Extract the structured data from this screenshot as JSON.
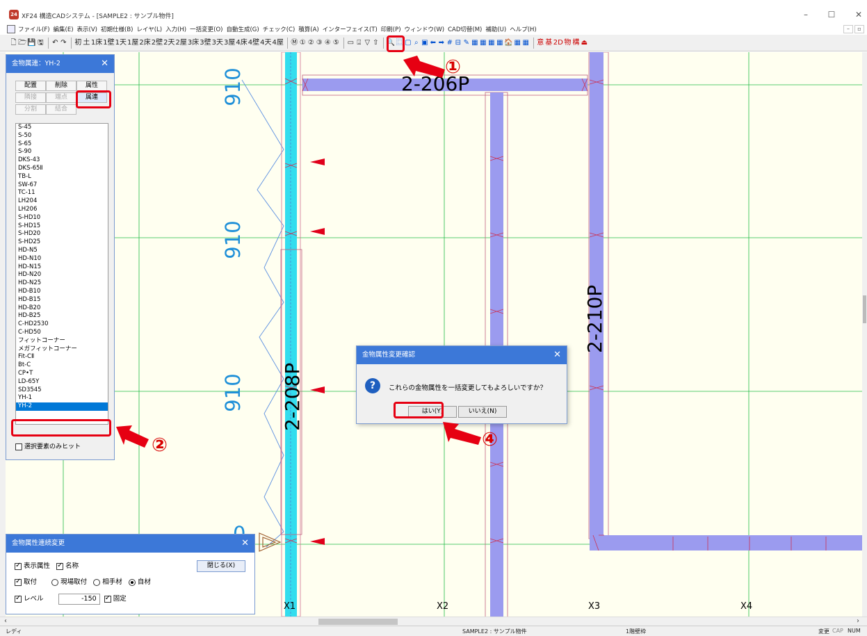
{
  "window": {
    "title": "XF24 構造CADシステム - [SAMPLE2 : サンプル物件]",
    "app_icon": "24"
  },
  "menu": [
    "ファイル(F)",
    "編集(E)",
    "表示(V)",
    "初期仕様(B)",
    "レイヤ(L)",
    "入力(H)",
    "一括変更(O)",
    "自動生成(G)",
    "チェック(C)",
    "積算(A)",
    "インターフェイス(T)",
    "印刷(P)",
    "ウィンドウ(W)",
    "CAD切替(M)",
    "補助(U)",
    "ヘルプ(H)"
  ],
  "toolbar": {
    "file_icons": [
      "🗋",
      "🗁",
      "💾",
      "🖫"
    ],
    "undo_icons": [
      "↶",
      "↷"
    ],
    "layers": [
      "初",
      "土",
      "1床",
      "1壁",
      "1天",
      "1屋",
      "2床",
      "2壁",
      "2天",
      "2屋",
      "3床",
      "3壁",
      "3天",
      "3屋",
      "4床",
      "4壁",
      "4天",
      "4屋"
    ],
    "circles": [
      "Ⓜ",
      "①",
      "②",
      "③",
      "④",
      "⑤"
    ],
    "tools_mid": [
      "▭",
      "⍗",
      "▽",
      "⇧"
    ],
    "tools_view": [
      "🔍",
      "⿴",
      "▢",
      "⌕",
      "▣",
      "⬅",
      "➡",
      "#",
      "⊟",
      "✎",
      "▦",
      "▦",
      "▦",
      "▦",
      "🏠",
      "▦",
      "▦"
    ],
    "right_labels": [
      "意",
      "基",
      "2D",
      "物",
      "構",
      "⏏"
    ]
  },
  "kanagu_panel": {
    "title": "金物属連：YH-2",
    "buttons": [
      "配置",
      "削除",
      "属性",
      "隣接",
      "端点",
      "属連",
      "分割",
      "結合"
    ],
    "list": [
      "S-45",
      "S-50",
      "S-65",
      "S-90",
      "DKS-43",
      "DKS-65Ⅱ",
      "TB-L",
      "SW-67",
      "TC-11",
      "LH204",
      "LH206",
      "S-HD10",
      "S-HD15",
      "S-HD20",
      "S-HD25",
      "HD-N5",
      "HD-N10",
      "HD-N15",
      "HD-N20",
      "HD-N25",
      "HD-B10",
      "HD-B15",
      "HD-B20",
      "HD-B25",
      "C-HD2530",
      "C-HD50",
      "フィットコーナー",
      "メガフィットコーナー",
      "Fit-CⅡ",
      "Bt-C",
      "CP•T",
      "LD-65Y",
      "SD3545",
      "YH-1",
      "YH-2"
    ],
    "selected": "YH-2",
    "checkbox": "選択要素のみヒット"
  },
  "renzoku_panel": {
    "title": "金物属性連続変更",
    "display_attr": "表示属性",
    "name": "名称",
    "close": "閉じる(X)",
    "attach": "取付",
    "opt_genba": "現場取付",
    "opt_aite": "相手材",
    "opt_jizai": "自材",
    "level": "レベル",
    "level_value": "-150",
    "fixed": "固定"
  },
  "confirm_dialog": {
    "title": "金物属性変更確認",
    "message": "これらの金物属性を一括変更してもよろしいですか？",
    "yes": "はい(Y)",
    "no": "いいえ(N)"
  },
  "drawing": {
    "dims": [
      "910",
      "910",
      "910",
      "0"
    ],
    "members": [
      "2-206P",
      "2-210P",
      "2-208P"
    ],
    "axes": [
      "X1",
      "X2",
      "X3",
      "X4"
    ]
  },
  "callouts": [
    "①",
    "②",
    "④"
  ],
  "status": {
    "ready": "レディ",
    "file": "SAMPLE2 : サンプル物件",
    "layer": "1階壁枠",
    "flags": [
      "変更",
      "CAP",
      "NUM"
    ]
  },
  "colors": {
    "beam_fill": "#9b9bef",
    "beam_selected": "#33ddee",
    "grid_green": "#22bb44",
    "dim_blue": "#1e8fd8",
    "highlight_red": "#e60012",
    "title_blue": "#3c78d8"
  }
}
